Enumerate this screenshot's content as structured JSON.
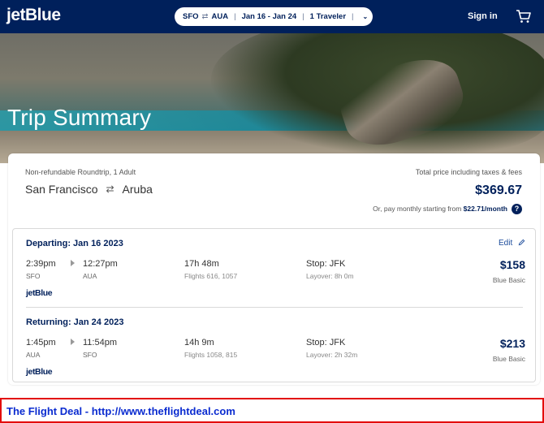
{
  "header": {
    "logo": "jetBlue",
    "search": {
      "origin": "SFO",
      "swap_symbol": "⇄",
      "destination": "AUA",
      "dates": "Jan 16 - Jan 24",
      "travelers": "1 Traveler",
      "chevron": "⌄"
    },
    "signin_label": "Sign in",
    "cart_icon": "cart-icon"
  },
  "hero": {
    "title": "Trip Summary"
  },
  "summary": {
    "meta": "Non-refundable Roundtrip, 1 Adult",
    "origin_city": "San Francisco",
    "swap_symbol": "⇄",
    "destination_city": "Aruba",
    "total_label": "Total price including taxes & fees",
    "total_price": "$369.67",
    "monthly_text": "Or, pay monthly starting from",
    "monthly_amount": "$22.71/month",
    "help_symbol": "?"
  },
  "legs": [
    {
      "title": "Departing: Jan 16 2023",
      "edit_label": "Edit",
      "depart_time": "2:39pm",
      "depart_code": "SFO",
      "arrive_time": "12:27pm",
      "arrive_code": "AUA",
      "duration": "17h 48m",
      "flights": "Flights 616, 1057",
      "stop": "Stop: JFK",
      "layover": "Layover: 8h 0m",
      "price": "$158",
      "fare": "Blue Basic",
      "airline_logo": "jetBlue"
    },
    {
      "title": "Returning: Jan 24 2023",
      "depart_time": "1:45pm",
      "depart_code": "AUA",
      "arrive_time": "11:54pm",
      "arrive_code": "SFO",
      "duration": "14h 9m",
      "flights": "Flights 1058, 815",
      "stop": "Stop: JFK",
      "layover": "Layover: 2h 32m",
      "price": "$213",
      "fare": "Blue Basic",
      "airline_logo": "jetBlue"
    }
  ],
  "footer": {
    "banner_text": "The Flight Deal - http://www.theflightdeal.com"
  },
  "colors": {
    "navy": "#00205b",
    "banner_border": "#e30d0d",
    "banner_text": "#0a2bd0"
  }
}
